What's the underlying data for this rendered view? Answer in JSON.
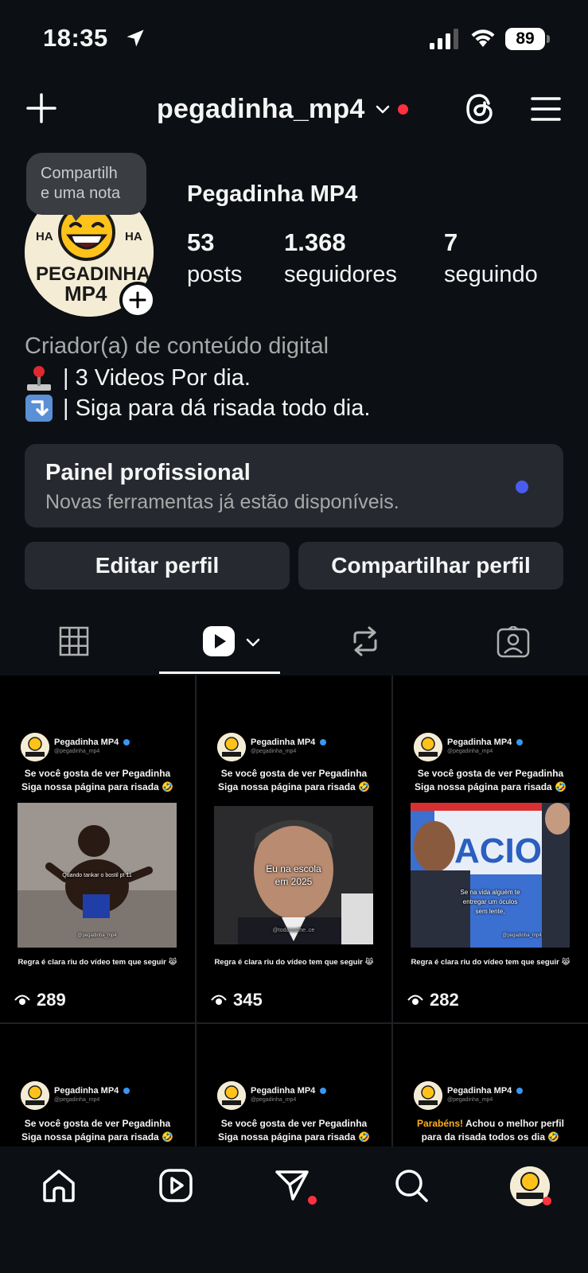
{
  "status_bar": {
    "time": "18:35",
    "battery": "89",
    "icons": [
      "location-arrow-icon",
      "signal-icon",
      "wifi-icon",
      "battery-icon"
    ]
  },
  "header": {
    "username": "pegadinha_mp4",
    "icons": [
      "plus-icon",
      "chevron-down-icon",
      "threads-icon",
      "menu-icon"
    ],
    "notification_color": "#ff3040"
  },
  "profile": {
    "note_line1": "Compartilh",
    "note_line2": "e uma nota",
    "avatar_text_top": "HA",
    "avatar_text_top2": "HA",
    "avatar_text_1": "PEGADINHA",
    "avatar_text_2": "MP4",
    "display_name": "Pegadinha MP4",
    "stats": [
      {
        "value": "53",
        "label": "posts"
      },
      {
        "value": "1.368",
        "label": "seguidores"
      },
      {
        "value": "7",
        "label": "seguindo"
      }
    ],
    "category": "Criador(a) de conteúdo digital",
    "bio": [
      {
        "icon": "joystick-icon",
        "text": "| 3 Videos Por dia."
      },
      {
        "icon": "arrow-down-icon",
        "text": "| Siga para dá risada todo dia."
      }
    ]
  },
  "panel": {
    "title": "Painel profissional",
    "subtitle": "Novas ferramentas já estão disponíveis.",
    "dot_color": "#4a5cf0"
  },
  "buttons": {
    "edit": "Editar perfil",
    "share": "Compartilhar perfil"
  },
  "tabs": [
    "grid-icon",
    "reels-icon",
    "reposts-icon",
    "tagged-icon"
  ],
  "posts": [
    {
      "account": "Pegadinha MP4",
      "handle": "@pegadinha_mp4",
      "caption1": "Se você gosta de ver Pegadinha",
      "caption2": "Siga nossa página para risada 🤣",
      "overlay": "Quando tankar o bostil pt 11",
      "watermark": "@pegadinha_mp4",
      "rule": "Regra é clara riu do vídeo tem que seguir 😹",
      "views": "289"
    },
    {
      "account": "Pegadinha MP4",
      "handle": "@pegadinha_mp4",
      "caption1": "Se você gosta de ver Pegadinha",
      "caption2": "Siga nossa página para risada 🤣",
      "overlay1": "Eu na escola",
      "overlay2": "em 2025",
      "watermark": "@todasasthe..ce",
      "rule": "Regra é clara riu do vídeo tem que seguir 😹",
      "views": "345"
    },
    {
      "account": "Pegadinha MP4",
      "handle": "@pegadinha_mp4",
      "caption1": "Se você gosta de ver Pegadinha",
      "caption2": "Siga nossa página para risada 🤣",
      "overlay1": "Se na vida alguém te",
      "overlay2": "entregar um óculos",
      "overlay3": "sem lente,",
      "sign": "ACION",
      "watermark": "@pegadinha_mp4",
      "rule": "Regra é clara riu do vídeo tem que seguir 😹",
      "views": "282"
    },
    {
      "account": "Pegadinha MP4",
      "handle": "@pegadinha_mp4",
      "caption1": "Se você gosta de ver Pegadinha",
      "caption2": "Siga nossa página para risada 🤣"
    },
    {
      "account": "Pegadinha MP4",
      "handle": "@pegadinha_mp4",
      "caption1": "Se você gosta de ver Pegadinha",
      "caption2": "Siga nossa página para risada 🤣"
    },
    {
      "account": "Pegadinha MP4",
      "handle": "@pegadinha_mp4",
      "caption1_highlight": "Parabéns!",
      "caption1_rest": " Achou o melhor perfil",
      "caption2": "para da risada todos os dia 🤣"
    }
  ],
  "bottom_nav": [
    "home-icon",
    "reels-icon",
    "direct-icon",
    "search-icon",
    "profile-avatar"
  ]
}
